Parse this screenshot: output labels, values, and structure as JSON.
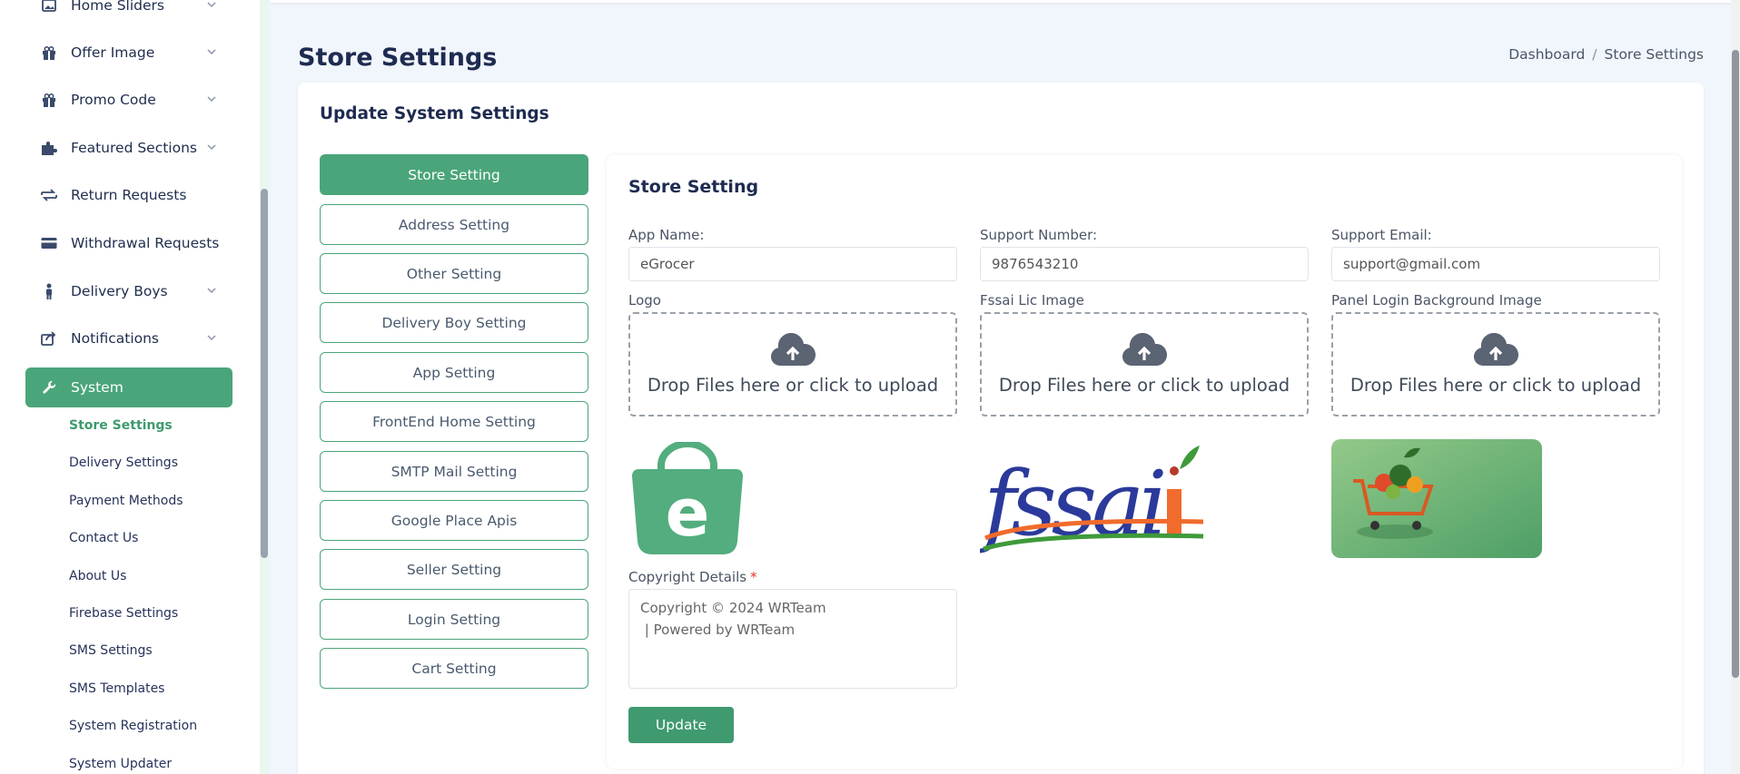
{
  "sidebar": {
    "items": [
      {
        "label": "Home Sliders",
        "icon": "image-icon"
      },
      {
        "label": "Offer Image",
        "icon": "gift-icon"
      },
      {
        "label": "Promo Code",
        "icon": "gift-icon"
      },
      {
        "label": "Featured Sections",
        "icon": "puzzle-icon"
      },
      {
        "label": "Return Requests",
        "icon": "return-icon"
      },
      {
        "label": "Withdrawal Requests",
        "icon": "card-icon"
      },
      {
        "label": "Delivery Boys",
        "icon": "person-icon"
      },
      {
        "label": "Notifications",
        "icon": "share-icon"
      },
      {
        "label": "System",
        "icon": "wrench-icon"
      }
    ],
    "sub_items": [
      "Store Settings",
      "Delivery Settings",
      "Payment Methods",
      "Contact Us",
      "About Us",
      "Firebase Settings",
      "SMS Settings",
      "SMS Templates",
      "System Registration",
      "System Updater"
    ]
  },
  "header": {
    "title": "Store Settings",
    "breadcrumb": [
      "Dashboard",
      "/",
      "Store Settings"
    ]
  },
  "card": {
    "title": "Update System Settings",
    "tabs": [
      "Store Setting",
      "Address Setting",
      "Other Setting",
      "Delivery Boy Setting",
      "App Setting",
      "FrontEnd Home Setting",
      "SMTP Mail Setting",
      "Google Place Apis",
      "Seller Setting",
      "Login Setting",
      "Cart Setting"
    ]
  },
  "form": {
    "title": "Store Setting",
    "app_name_label": "App Name:",
    "app_name_value": "eGrocer",
    "support_number_label": "Support Number:",
    "support_number_value": "9876543210",
    "support_email_label": "Support Email:",
    "support_email_value": "support@gmail.com",
    "logo_label": "Logo",
    "fssai_label": "Fssai Lic Image",
    "panel_bg_label": "Panel Login Background Image",
    "drop_text": "Drop Files here or click to upload",
    "copyright_label": "Copyright Details",
    "copyright_required": "*",
    "copyright_value": "Copyright © 2024 WRTeam\n | Powered by WRTeam",
    "update_label": "Update",
    "fssai_logo_text": "fssai",
    "logo_letter": "e"
  },
  "colors": {
    "accent": "#4ba57a",
    "title": "#1e2b50",
    "required": "#e0322f",
    "fssai_blue": "#2b3a9a",
    "fssai_orange": "#f06b2c"
  }
}
